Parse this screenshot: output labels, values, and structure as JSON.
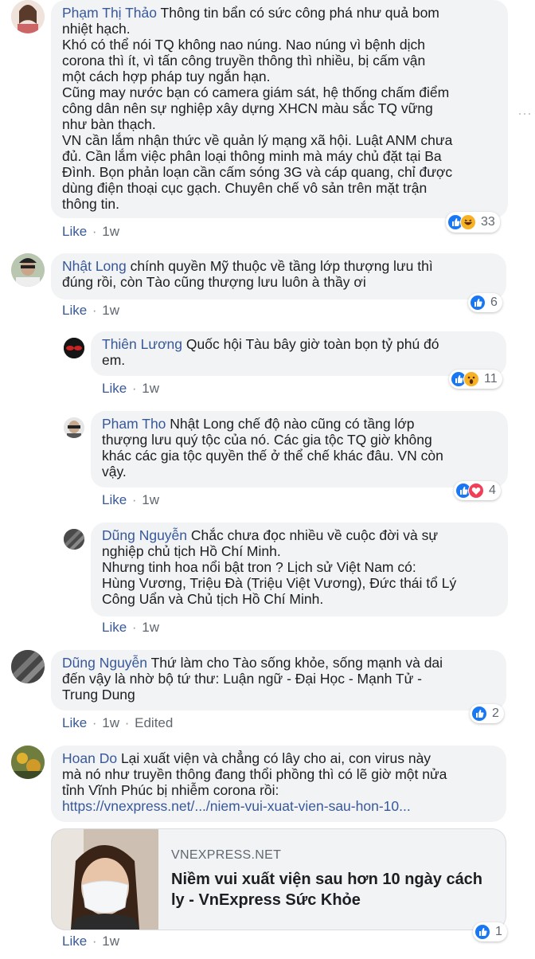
{
  "comments": [
    {
      "id": "c1",
      "author": "Phạm Thị Thảo",
      "text": " Thông tin bẩn có sức công phá như quả bom\nnhiệt hạch.\nKhó có thể nói TQ không nao núng. Nao núng vì bệnh dịch\ncorona thì ít, vì tấn công truyền thông thì nhiều, bị cấm vận\nmột cách hợp pháp tuy ngắn hạn.\nCũng may nước bạn có camera giám sát, hệ thống chấm điểm\ncông dân nên sự nghiệp xây dựng XHCN màu sắc TQ vững\nnhư bàn thạch.\nVN cần lắm nhận thức về quản lý mạng xã hội. Luật ANM chưa\nđủ. Cần lắm việc phân loại thông minh mà máy chủ đặt tại Ba\nĐình. Bọn phản loạn cần cấm sóng 3G và cáp quang, chỉ được\ndùng điện thoại cục gạch. Chuyên chế vô sản trên mặt trận\nthông tin.",
      "like_label": "Like",
      "time": "1w",
      "reaction_count": "33",
      "reactions": [
        "like",
        "haha"
      ]
    },
    {
      "id": "c2",
      "author": "Nhật Long",
      "text": " chính quyền Mỹ thuộc về tầng lớp thượng lưu thì\nđúng rồi, còn Tào cũng thượng lưu luôn à thầy ơi",
      "like_label": "Like",
      "time": "1w",
      "reaction_count": "6",
      "reactions": [
        "like"
      ]
    },
    {
      "id": "c3",
      "author": "Thiên Lương",
      "text": " Quốc hội Tàu bây giờ toàn bọn tỷ phú đó\nem.",
      "like_label": "Like",
      "time": "1w",
      "reaction_count": "11",
      "reactions": [
        "like",
        "wow"
      ]
    },
    {
      "id": "c4",
      "author": "Pham Tho",
      "text": " Nhật Long chế độ nào cũng có tầng lớp\nthượng lưu quý tộc của nó. Các gia tộc TQ giờ không\nkhác các gia tộc quyền thế ở thể chế khác đâu. VN còn\nvậy.",
      "like_label": "Like",
      "time": "1w",
      "reaction_count": "4",
      "reactions": [
        "like",
        "love"
      ]
    },
    {
      "id": "c5",
      "author": "Dũng Nguyễn",
      "text": " Chắc chưa đọc nhiều về cuộc đời và sự\nnghiệp chủ tịch Hồ Chí Minh.\nNhưng tinh hoa nổi bật tron ? Lịch sử Việt Nam có:\nHùng Vương, Triệu Đà (Triệu Việt Vương), Đức thái tổ Lý\nCông Uẩn và Chủ tịch Hồ Chí Minh.",
      "like_label": "Like",
      "time": "1w",
      "reaction_count": "",
      "reactions": []
    },
    {
      "id": "c6",
      "author": "Dũng Nguyễn",
      "text": " Thứ làm cho Tào sống khỏe, sống mạnh và dai\nđến vậy là nhờ bộ tứ thư: Luận ngữ - Đại Học - Mạnh Tử -\nTrung Dung",
      "like_label": "Like",
      "time": "1w",
      "edited": "Edited",
      "reaction_count": "2",
      "reactions": [
        "like"
      ]
    },
    {
      "id": "c7",
      "author": "Hoan Do",
      "text": " Lại xuất viện và chẳng có lây cho ai, con virus này\nmà nó như truyền thông đang thổi phồng thì có lẽ giờ một nửa\ntỉnh Vĩnh Phúc bị nhiễm corona rồi:\n",
      "link_text": "https://vnexpress.net/.../niem-vui-xuat-vien-sau-hon-10...",
      "like_label": "Like",
      "time": "1w",
      "reaction_count": "1",
      "reactions": [
        "like"
      ]
    }
  ],
  "link_preview": {
    "domain": "VNEXPRESS.NET",
    "title": "Niềm vui xuất viện sau hơn 10 ngày cách ly - VnExpress Sức Khỏe"
  },
  "colors": {
    "name": "#385898",
    "bubble": "#f2f3f5",
    "meta": "#606770",
    "like_blue": "#1877f2"
  }
}
